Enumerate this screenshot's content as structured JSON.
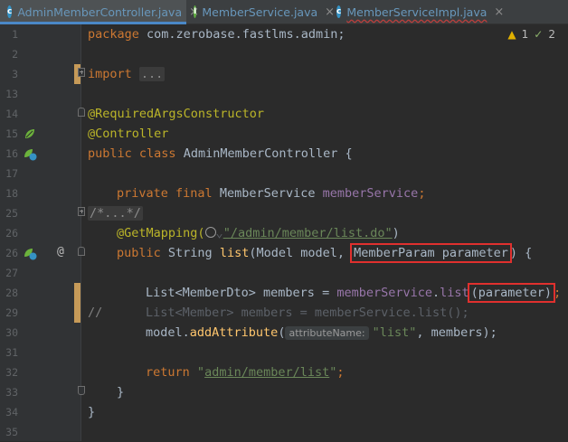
{
  "tabs": [
    {
      "label": "AdminMemberController.java",
      "icon": "class-icon",
      "icon_letter": "c",
      "active": true,
      "close": "×"
    },
    {
      "label": "MemberService.java",
      "icon": "interface-icon",
      "icon_letter": "I",
      "active": false,
      "close": "×"
    },
    {
      "label": "MemberServiceImpl.java",
      "icon": "class-icon",
      "icon_letter": "c",
      "active": false,
      "close": "×"
    }
  ],
  "inspection": {
    "warnings": "1",
    "weak_warnings": "2",
    "warning_symbol": "▲",
    "weak_symbol": "✓"
  },
  "lines": [
    {
      "num": "1",
      "package_kw": "package",
      "package_name": "com.zerobase.fastlms.admin;"
    },
    {
      "num": "2"
    },
    {
      "num": "3",
      "import_kw": "import",
      "import_fold": "..."
    },
    {
      "num": "13"
    },
    {
      "num": "14",
      "annotation": "@RequiredArgsConstructor"
    },
    {
      "num": "15",
      "annotation": "@Controller"
    },
    {
      "num": "16",
      "kw_public": "public",
      "kw_class": "class",
      "class_name": "AdminMemberController",
      "brace": "{"
    },
    {
      "num": "17"
    },
    {
      "num": "18",
      "kw_private": "private",
      "kw_final": "final",
      "type": "MemberService",
      "field": "memberService",
      "semi": ";"
    },
    {
      "num": "25",
      "fold_comment": "/*...*/"
    },
    {
      "num": "26",
      "annotation": "@GetMapping(",
      "path": "\"/admin/member/list.do\"",
      "close": ")"
    },
    {
      "num": "26",
      "kw_public": "public",
      "ret_type": "String",
      "method": "list",
      "params_pre": "(Model model,",
      "param_boxed": "MemberParam parameter",
      "params_post": ") {",
      "at": "@"
    },
    {
      "num": "27"
    },
    {
      "num": "28",
      "pre": "List<MemberDto> members = ",
      "field": "memberService",
      "dot": ".",
      "call": "list",
      "boxed": "(parameter)",
      "post": ";"
    },
    {
      "num": "29",
      "comment_marker": "//",
      "muted": "List<Member> members = memberService.list();"
    },
    {
      "num": "30",
      "obj": "model",
      "dot": ".",
      "call": "addAttribute",
      "open": "(",
      "hint": "attributeName:",
      "string": "\"list\"",
      "rest": ", members);"
    },
    {
      "num": "31"
    },
    {
      "num": "32",
      "kw_return": "return",
      "string_q1": "\"",
      "string_body": "admin/member/list",
      "string_q2": "\"",
      "semi": ";"
    },
    {
      "num": "33",
      "brace": "}"
    },
    {
      "num": "34",
      "brace": "}"
    },
    {
      "num": "35"
    }
  ]
}
